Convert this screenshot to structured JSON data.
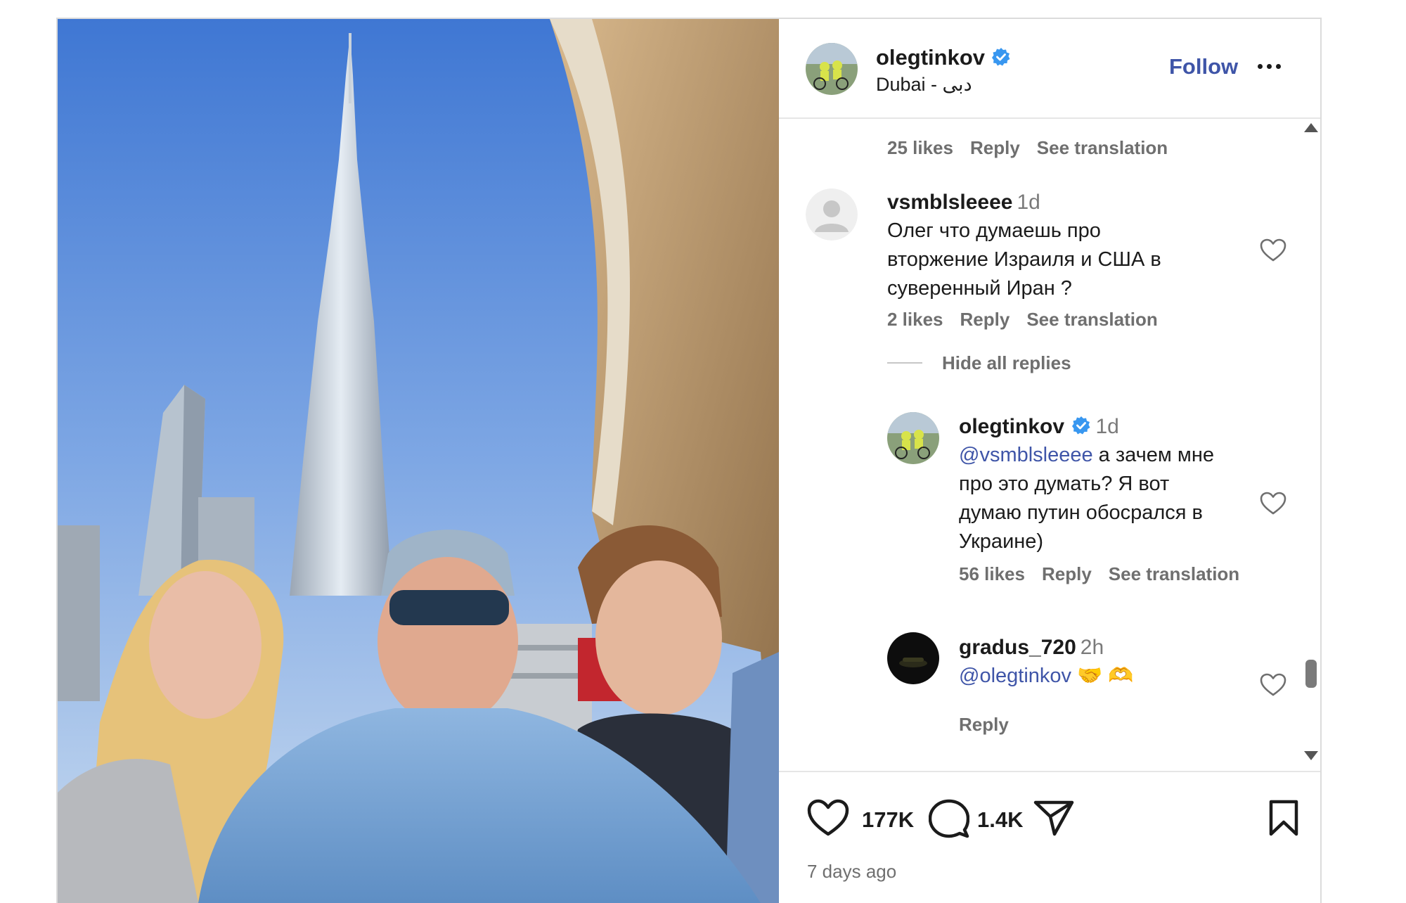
{
  "header": {
    "username": "olegtinkov",
    "location": "Dubai - دبی",
    "follow_label": "Follow",
    "verified_icon": "verified-badge-icon",
    "more_icon": "more-options-icon"
  },
  "comments": {
    "prev_meta": {
      "likes": "25 likes",
      "reply": "Reply",
      "translate": "See translation"
    },
    "comment1": {
      "username": "vsmblsleeee",
      "time": "1d",
      "lines": [
        "Олег что думаешь про",
        "вторжение Израиля и США в",
        "суверенный Иран ?"
      ],
      "likes": "2 likes",
      "reply": "Reply",
      "translate": "See translation"
    },
    "hide_replies": "Hide all replies",
    "reply1": {
      "username": "olegtinkov",
      "time": "1d",
      "mention": "@vsmblsleeee",
      "line1_rest": " а зачем мне",
      "lines": [
        "про это думать? Я вот",
        "думаю путин обосрался в",
        "Украине)"
      ],
      "likes": "56 likes",
      "reply": "Reply",
      "translate": "See translation"
    },
    "comment2": {
      "username": "gradus_720",
      "time": "2h",
      "mention": "@olegtinkov",
      "emoji": "🤝 🫶",
      "reply": "Reply"
    }
  },
  "actions": {
    "likes": "177K",
    "comments": "1.4K",
    "time": "7 days ago"
  },
  "colors": {
    "link": "#3f55a8",
    "verified": "#3897f0",
    "muted": "#6f6f6f",
    "border": "#dbdbdb"
  }
}
